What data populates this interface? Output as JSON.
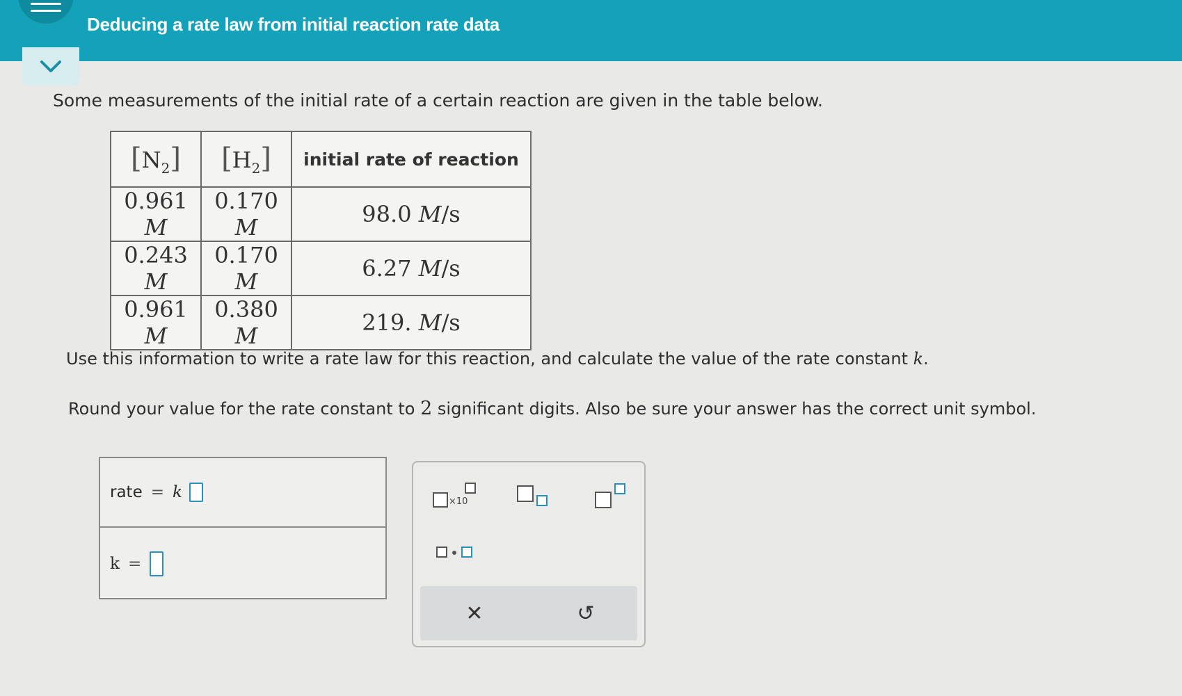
{
  "header": {
    "title": "Deducing a rate law from initial reaction rate data"
  },
  "problem": {
    "intro": "Some measurements of the initial rate of a certain reaction are given in the table below.",
    "table": {
      "headers": [
        {
          "species": "N",
          "subscript": "2"
        },
        {
          "species": "H",
          "subscript": "2"
        },
        {
          "label": "initial rate of reaction"
        }
      ],
      "rows": [
        {
          "n2_value": "0.961",
          "n2_unit": "M",
          "h2_value": "0.170",
          "h2_unit": "M",
          "rate_value": "98.0",
          "rate_unit": "M",
          "rate_unit_tail": "/s"
        },
        {
          "n2_value": "0.243",
          "n2_unit": "M",
          "h2_value": "0.170",
          "h2_unit": "M",
          "rate_value": "6.27",
          "rate_unit": "M",
          "rate_unit_tail": "/s"
        },
        {
          "n2_value": "0.961",
          "n2_unit": "M",
          "h2_value": "0.380",
          "h2_unit": "M",
          "rate_value": "219.",
          "rate_unit": "M",
          "rate_unit_tail": "/s"
        }
      ]
    },
    "instruction1": "Use this information to write a rate law for this reaction, and calculate the value of the rate constant",
    "instruction1_var": "k",
    "instruction1_end": ".",
    "instruction2_a": "Round your value for the rate constant to",
    "instruction2_num": "2",
    "instruction2_b": "significant digits. Also be sure your answer has the correct unit symbol."
  },
  "answer": {
    "rate_label": "rate",
    "equals": "=",
    "k_italic": "k",
    "k_label": "k"
  },
  "palette": {
    "sci_label": "×10",
    "clear_symbol": "✕",
    "undo_symbol": "↺"
  }
}
